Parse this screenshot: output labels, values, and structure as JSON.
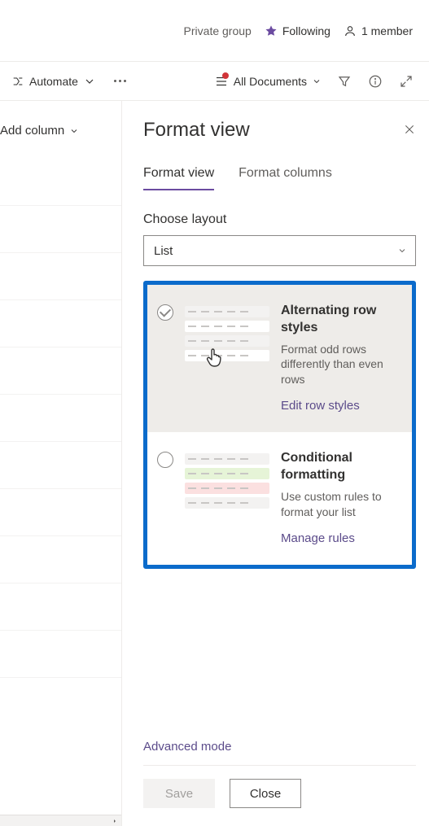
{
  "header": {
    "group_type": "Private group",
    "following": "Following",
    "members": "1 member"
  },
  "cmdbar": {
    "automate": "Automate",
    "view_label": "All Documents"
  },
  "leftpane": {
    "add_column": "Add column"
  },
  "panel": {
    "title": "Format view",
    "tabs": {
      "format_view": "Format view",
      "format_columns": "Format columns"
    },
    "choose_layout_label": "Choose layout",
    "layout_value": "List",
    "options": {
      "alt": {
        "title": "Alternating row styles",
        "desc": "Format odd rows differently than even rows",
        "link": "Edit row styles"
      },
      "cond": {
        "title": "Conditional formatting",
        "desc": "Use custom rules to format your list",
        "link": "Manage rules"
      }
    },
    "advanced": "Advanced mode",
    "save": "Save",
    "close": "Close"
  }
}
